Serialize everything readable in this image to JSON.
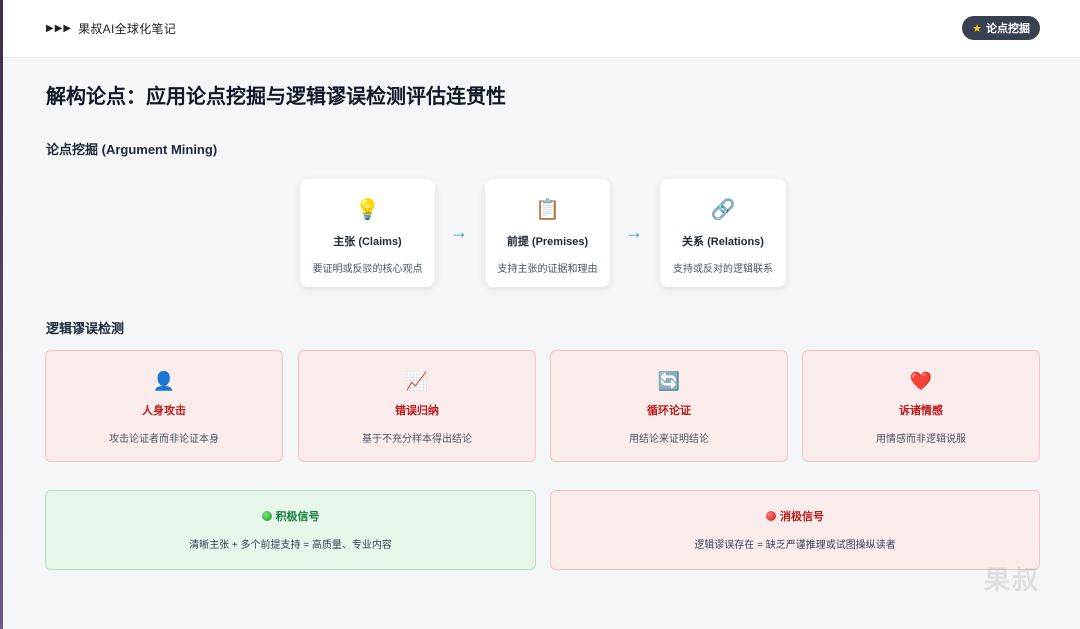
{
  "header": {
    "brand_arrows": "▶▶▶",
    "brand": "果叔AI全球化笔记",
    "pill_icon": "★",
    "pill_label": "论点挖掘"
  },
  "page_title": "解构论点：应用论点挖掘与逻辑谬误检测评估连贯性",
  "mining": {
    "title": "论点挖掘 (Argument Mining)",
    "arrow": "→",
    "cards": [
      {
        "icon": "💡",
        "icon_name": "lightbulb-icon",
        "title": "主张 (Claims)",
        "desc": "要证明或反驳的核心观点"
      },
      {
        "icon": "📋",
        "icon_name": "clipboard-icon",
        "title": "前提 (Premises)",
        "desc": "支持主张的证据和理由"
      },
      {
        "icon": "🔗",
        "icon_name": "link-icon",
        "title": "关系 (Relations)",
        "desc": "支持或反对的逻辑联系"
      }
    ]
  },
  "fallacies": {
    "title": "逻辑谬误检测",
    "items": [
      {
        "icon": "👤",
        "icon_name": "person-icon",
        "title": "人身攻击",
        "desc": "攻击论证者而非论证本身"
      },
      {
        "icon": "📈",
        "icon_name": "chart-up-icon",
        "title": "错误归纳",
        "desc": "基于不充分样本得出结论"
      },
      {
        "icon": "🔄",
        "icon_name": "cycle-icon",
        "title": "循环论证",
        "desc": "用结论来证明结论"
      },
      {
        "icon": "❤️",
        "icon_name": "heart-icon",
        "title": "诉诸情感",
        "desc": "用情感而非逻辑说服"
      }
    ]
  },
  "signals": {
    "positive": {
      "title": "积极信号",
      "desc": "清晰主张 + 多个前提支持 = 高质量、专业内容",
      "color": "#15803d"
    },
    "negative": {
      "title": "消极信号",
      "desc": "逻辑谬误存在 = 缺乏严谨推理或试图操纵读者",
      "color": "#b91c1c"
    }
  },
  "watermark": "果叔"
}
